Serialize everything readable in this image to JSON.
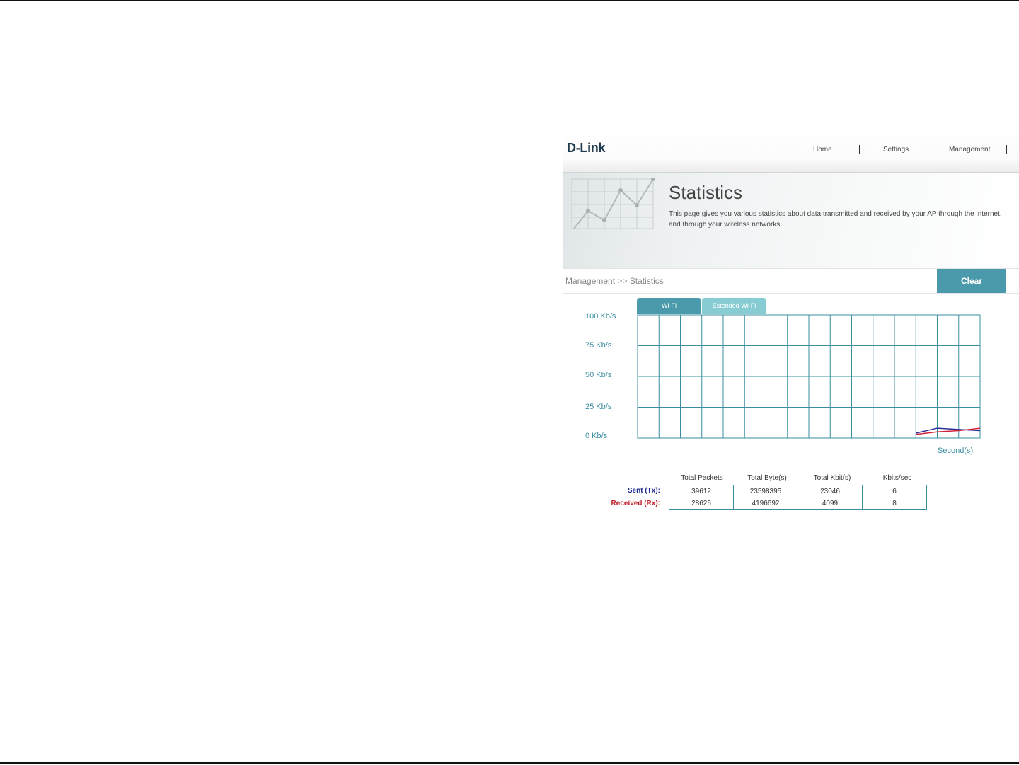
{
  "brand": {
    "logo": "D-Link"
  },
  "nav": {
    "items": [
      "Home",
      "Settings",
      "Management"
    ]
  },
  "header": {
    "title": "Statistics",
    "description": "This page gives you various statistics about data transmitted and received by your AP through the internet, and through your wireless networks."
  },
  "breadcrumb": "Management >> Statistics",
  "actions": {
    "clear_label": "Clear"
  },
  "tabs": [
    {
      "label": "Wi-Fi",
      "active": true
    },
    {
      "label": "Extended Wi-Fi",
      "active": false
    }
  ],
  "chart_data": {
    "type": "line",
    "ylabels": [
      "100 Kb/s",
      "75 Kb/s",
      "50 Kb/s",
      "25 Kb/s",
      "0 Kb/s"
    ],
    "ylim": [
      0,
      100
    ],
    "xlabel": "Second(s)",
    "grid": true,
    "x": [
      13,
      14,
      15,
      16
    ],
    "series": [
      {
        "role": "sent",
        "color": "#2b2f9a",
        "values": [
          4,
          8,
          7,
          6
        ]
      },
      {
        "role": "received",
        "color": "#d0233a",
        "values": [
          3,
          5,
          6,
          8
        ]
      }
    ]
  },
  "stats": {
    "columns": [
      "Total Packets",
      "Total Byte(s)",
      "Total Kbit(s)",
      "Kbits/sec"
    ],
    "rows": [
      {
        "label": "Sent (Tx):",
        "values": [
          "39612",
          "23598395",
          "23046",
          "6"
        ]
      },
      {
        "label": "Received (Rx):",
        "values": [
          "28626",
          "4196692",
          "4099",
          "8"
        ]
      }
    ]
  },
  "colors": {
    "accent": "#4a9aab",
    "tab_inactive": "#86ccd2",
    "grid": "#3a8ea0",
    "tx": "#1e2a8c",
    "rx": "#c0202a"
  }
}
